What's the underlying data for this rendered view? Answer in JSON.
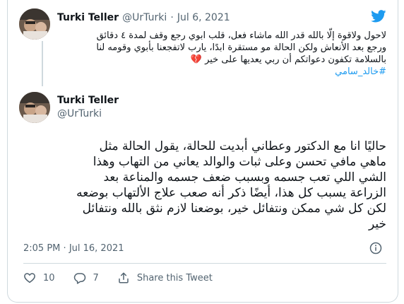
{
  "quoted_tweet": {
    "author_name": "Turki Teller",
    "author_handle": "@UrTurki",
    "separator": "·",
    "date": "Jul 6, 2021",
    "text_lines": [
      "لاحول ولاقوة إلّا بالله قدر الله ماشاء فعل، قلب ابوي رجع وقف لمدة ٤ دقائق",
      "ورجع بعد الأنعاش ولكن الحالة مو مستقرة ابدًا، يارب لاتفجعنا بأبوي وقومه لنا",
      "بالسلامة  تكفون دعواتكم أن ربي يعديها على خير 💔"
    ],
    "hashtag": "#خالد_سامي"
  },
  "main_tweet": {
    "author_name": "Turki Teller",
    "author_handle": "@UrTurki",
    "text_lines": [
      "حاليًا انا مع الدكتور وعطاني أبديت للحالة، يقول الحالة مثل",
      "ماهي مافي تحسن وعلى ثبات والوالد يعاني من التهاب وهذا",
      "الشي اللي تعب جسمه وبسبب ضعف جسمه والمناعة بعد",
      "الزراعة يسبب كل هذا، أيضًا ذكر أنه صعب علاج الألتهاب بوضعه",
      "لكن كل شي ممكن ونتفائل خير، بوضعنا لازم نثق بالله ونتفائل",
      "خير"
    ],
    "time": "2:05 PM",
    "separator": "·",
    "date": "Jul 16, 2021"
  },
  "actions": {
    "likes": "10",
    "replies": "7",
    "share_label": "Share this Tweet"
  },
  "icons": {
    "brand": "twitter-bird-icon",
    "info": "info-icon",
    "like": "heart-icon",
    "reply": "reply-bubble-icon",
    "share": "share-icon"
  },
  "colors": {
    "brand": "#1d9bf0",
    "text": "#0f1419",
    "muted": "#536471",
    "border": "#cfd9de"
  }
}
